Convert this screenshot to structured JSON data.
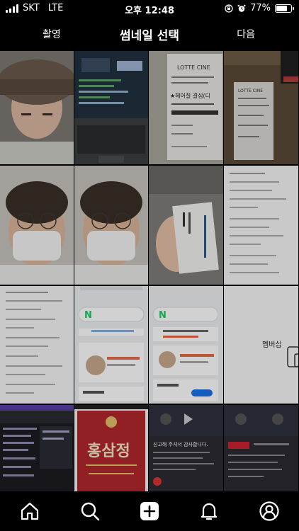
{
  "status_bar": {
    "carrier": "SKT",
    "network": "LTE",
    "time": "오후 12:48",
    "battery": "77%",
    "battery_level": 0.77
  },
  "header": {
    "left_label": "촬영",
    "title": "썸네일 선택",
    "right_label": "다음"
  },
  "grid": {
    "thumbnails": [
      {
        "subject": "person-beanie"
      },
      {
        "subject": "laptop-screen"
      },
      {
        "subject": "cinema-ticket",
        "text": "LOTTE CINE",
        "text2": "★헤어질 결심(디"
      },
      {
        "subject": "receipt-coffee",
        "text": "LOTTE CINE"
      },
      {
        "subject": "person-mask"
      },
      {
        "subject": "person-mask"
      },
      {
        "subject": "business-card"
      },
      {
        "subject": "document-screenshot"
      },
      {
        "subject": "document-screenshot"
      },
      {
        "subject": "naver-app",
        "text": "N"
      },
      {
        "subject": "naver-app",
        "text": "N"
      },
      {
        "subject": "app-screenshot",
        "text": "멤버십"
      },
      {
        "subject": "video-editor"
      },
      {
        "subject": "ginseng-pack",
        "text": "홍삼정"
      },
      {
        "subject": "video-editor",
        "text": "신고해 주셔서 감사합니다."
      },
      {
        "subject": "video-editor"
      }
    ]
  },
  "bottom_nav": {
    "items": [
      {
        "icon": "home-icon"
      },
      {
        "icon": "search-icon"
      },
      {
        "icon": "add-post-icon"
      },
      {
        "icon": "bell-icon"
      },
      {
        "icon": "profile-icon"
      }
    ]
  }
}
